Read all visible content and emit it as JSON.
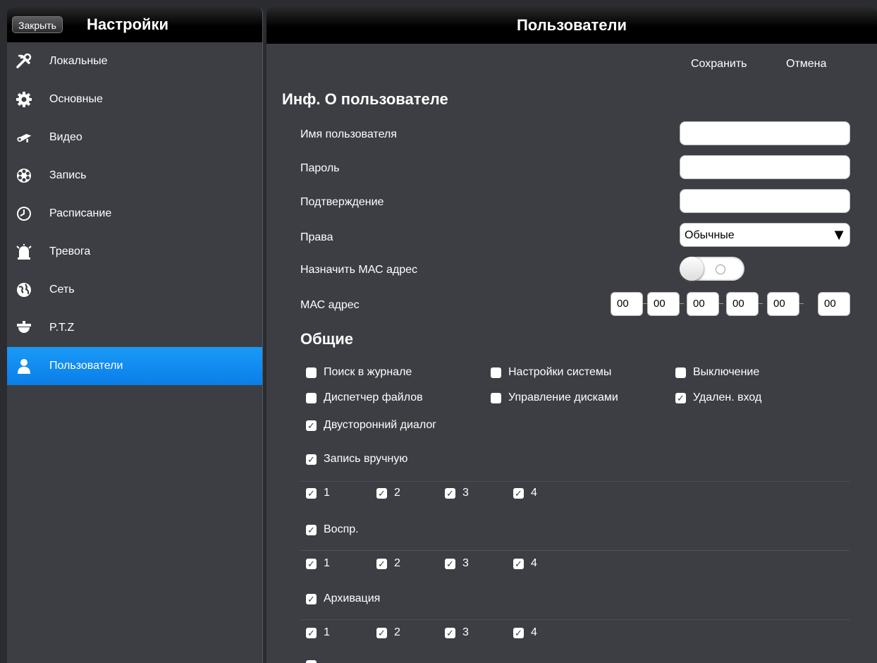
{
  "sidebar": {
    "close_label": "Закрыть",
    "title": "Настройки",
    "items": [
      {
        "label": "Локальные",
        "icon": "tools-icon"
      },
      {
        "label": "Основные",
        "icon": "gear-icon"
      },
      {
        "label": "Видео",
        "icon": "camera-icon"
      },
      {
        "label": "Запись",
        "icon": "film-reel-icon"
      },
      {
        "label": "Расписание",
        "icon": "clock-icon"
      },
      {
        "label": "Тревога",
        "icon": "alarm-icon"
      },
      {
        "label": "Сеть",
        "icon": "globe-icon"
      },
      {
        "label": "P.T.Z",
        "icon": "dome-camera-icon"
      },
      {
        "label": "Пользователи",
        "icon": "user-icon",
        "active": true
      }
    ]
  },
  "main": {
    "title": "Пользователи",
    "save_label": "Сохранить",
    "cancel_label": "Отмена",
    "user_info_title": "Инф. О пользователе",
    "fields": {
      "username_label": "Имя пользователя",
      "username_value": "",
      "password_label": "Пароль",
      "password_value": "",
      "confirm_label": "Подтверждение",
      "confirm_value": "",
      "rights_label": "Права",
      "rights_value": "Обычные",
      "assign_mac_label": "Назначить МАС адрес",
      "assign_mac_on": false,
      "mac_label": "МАС адрес",
      "mac_octets": [
        "00",
        "00",
        "00",
        "00",
        "00",
        "00"
      ]
    },
    "general_title": "Общие",
    "permissions": [
      {
        "label": "Поиск в журнале",
        "checked": false
      },
      {
        "label": "Настройки системы",
        "checked": false
      },
      {
        "label": "Выключение",
        "checked": false
      },
      {
        "label": "Диспетчер файлов",
        "checked": false
      },
      {
        "label": "Управление дисками",
        "checked": false
      },
      {
        "label": "Удален. вход",
        "checked": true
      },
      {
        "label": "Двусторонний диалог",
        "checked": true
      }
    ],
    "groups": [
      {
        "label": "Запись вручную",
        "checked": true,
        "channels": [
          {
            "label": "1",
            "checked": true
          },
          {
            "label": "2",
            "checked": true
          },
          {
            "label": "3",
            "checked": true
          },
          {
            "label": "4",
            "checked": true
          }
        ]
      },
      {
        "label": "Воспр.",
        "checked": true,
        "channels": [
          {
            "label": "1",
            "checked": true
          },
          {
            "label": "2",
            "checked": true
          },
          {
            "label": "3",
            "checked": true
          },
          {
            "label": "4",
            "checked": true
          }
        ]
      },
      {
        "label": "Архивация",
        "checked": true,
        "channels": [
          {
            "label": "1",
            "checked": true
          },
          {
            "label": "2",
            "checked": true
          },
          {
            "label": "3",
            "checked": true
          },
          {
            "label": "4",
            "checked": true
          }
        ]
      }
    ],
    "colors": {
      "active_item": "#1a9af7",
      "panel_bg": "#3d3e44",
      "header_bg": "#000000"
    }
  }
}
